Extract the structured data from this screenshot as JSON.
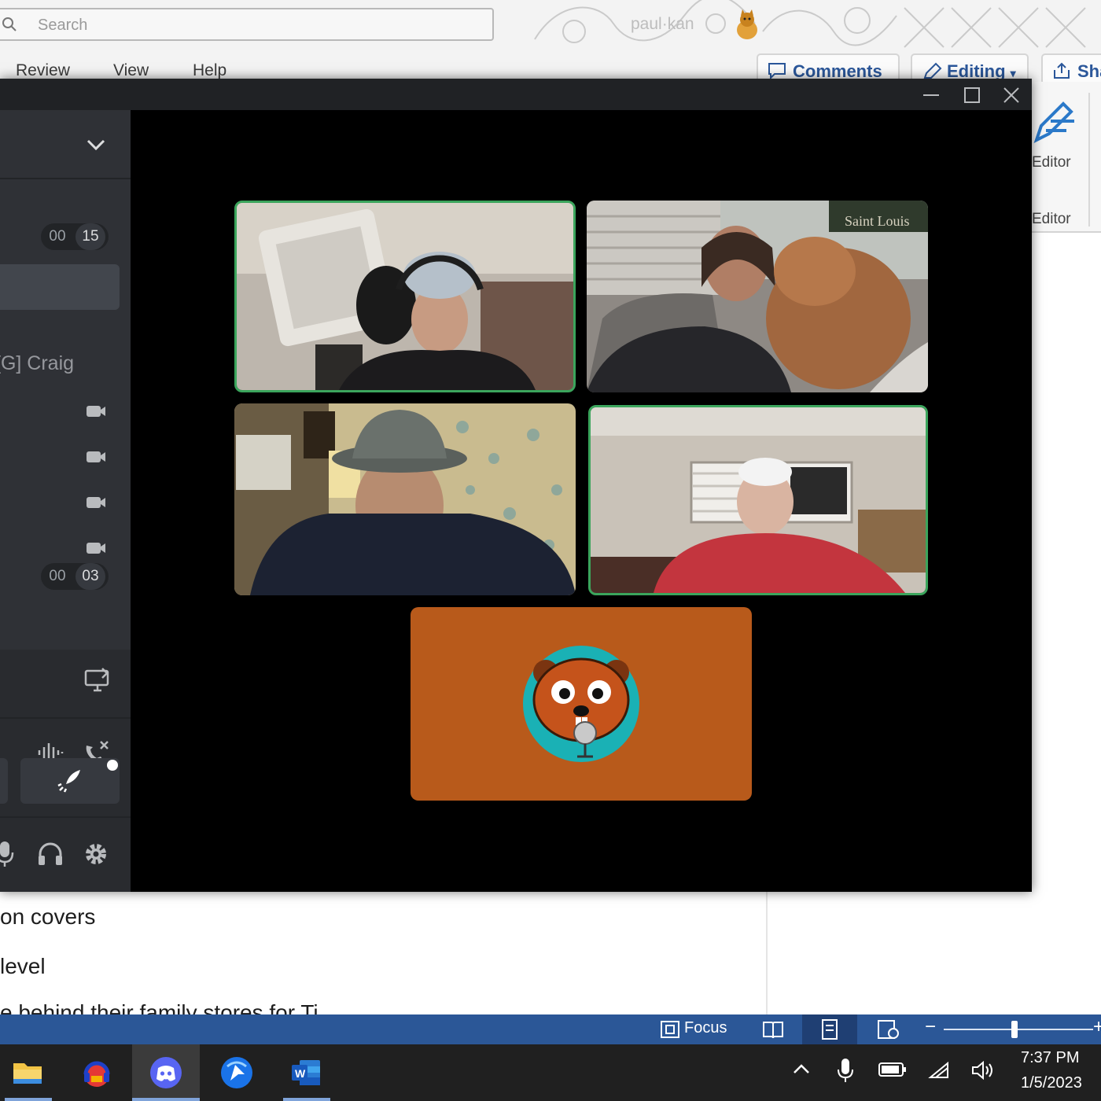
{
  "word": {
    "search_placeholder": "Search",
    "user_name": "paul·kan",
    "tabs": [
      "Review",
      "View",
      "Help"
    ],
    "buttons": {
      "comments": "Comments",
      "editing": "Editing",
      "share": "Sha"
    },
    "editor_label": "Editor",
    "editor_group_label": "Editor",
    "doc_lines": [
      "on covers",
      "level",
      "e behind their family stores for Ti"
    ],
    "status": {
      "focus": "Focus"
    }
  },
  "discord": {
    "timer_top": {
      "a": "00",
      "b": "15"
    },
    "timer_bottom": {
      "a": "00",
      "b": "03"
    },
    "member_name": "[G] Craig",
    "cam_rows": 4,
    "video_tiles": [
      {
        "name": "man-with-headset",
        "speaking": true
      },
      {
        "name": "woman-with-dog",
        "speaking": false,
        "sign": "Saint Louis"
      },
      {
        "name": "man-in-hat",
        "speaking": false
      },
      {
        "name": "man-in-red-shirt",
        "speaking": true
      }
    ],
    "avatar_tile": {
      "name": "beaver-avatar",
      "bg": "#b85a1b",
      "circle": "#1ab1b5"
    }
  },
  "taskbar": {
    "apps": [
      "file-explorer",
      "headphones-app",
      "discord",
      "arrow-app",
      "word"
    ],
    "active": "discord",
    "time": "7:37 PM",
    "date": "1/5/2023"
  },
  "colors": {
    "discord_dark": "#202225",
    "discord_sidebar": "#2f3136",
    "speaking_green": "#3ba55c",
    "word_blue": "#2b5797",
    "taskbar": "#202020"
  }
}
